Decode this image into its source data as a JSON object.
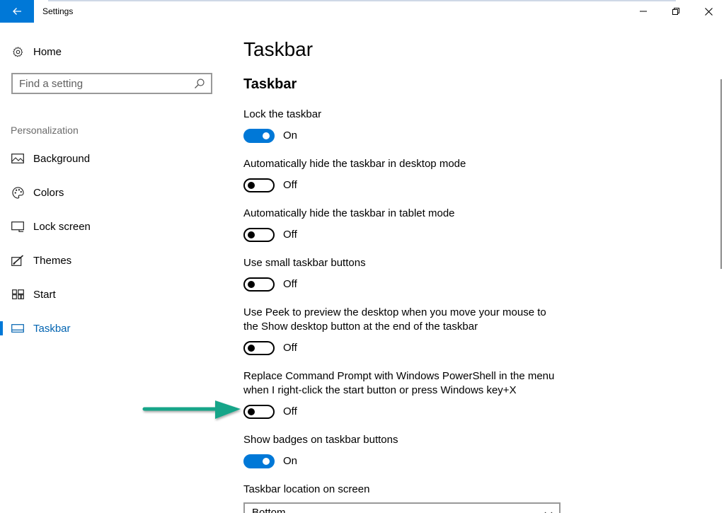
{
  "window": {
    "title": "Settings",
    "accent_color": "#0078d7"
  },
  "icons": {
    "back": "arrow-left-icon",
    "minimize": "minimize-icon",
    "maximize": "restore-icon",
    "close": "close-icon",
    "home": "gear-icon",
    "search": "search-icon",
    "background": "picture-icon",
    "colors": "palette-icon",
    "lock_screen": "monitor-icon",
    "themes": "brush-icon",
    "start": "start-tiles-icon",
    "taskbar": "taskbar-icon",
    "dropdown": "chevron-down-icon",
    "annotation": "arrow-right-icon"
  },
  "sidebar": {
    "home_label": "Home",
    "search_placeholder": "Find a setting",
    "section_label": "Personalization",
    "items": [
      {
        "label": "Background"
      },
      {
        "label": "Colors"
      },
      {
        "label": "Lock screen"
      },
      {
        "label": "Themes"
      },
      {
        "label": "Start"
      },
      {
        "label": "Taskbar",
        "active": true
      }
    ]
  },
  "main": {
    "page_title": "Taskbar",
    "section_title": "Taskbar",
    "settings": [
      {
        "label": "Lock the taskbar",
        "state": "On"
      },
      {
        "label": "Automatically hide the taskbar in desktop mode",
        "state": "Off"
      },
      {
        "label": "Automatically hide the taskbar in tablet mode",
        "state": "Off"
      },
      {
        "label": "Use small taskbar buttons",
        "state": "Off"
      },
      {
        "label": "Use Peek to preview the desktop when you move your mouse to the Show desktop button at the end of the taskbar",
        "state": "Off"
      },
      {
        "label": "Replace Command Prompt with Windows PowerShell in the menu when I right-click the start button or press Windows key+X",
        "state": "Off"
      },
      {
        "label": "Show badges on taskbar buttons",
        "state": "On"
      }
    ],
    "location_label": "Taskbar location on screen",
    "location_value": "Bottom"
  },
  "annotation": {
    "color": "#17a589"
  }
}
